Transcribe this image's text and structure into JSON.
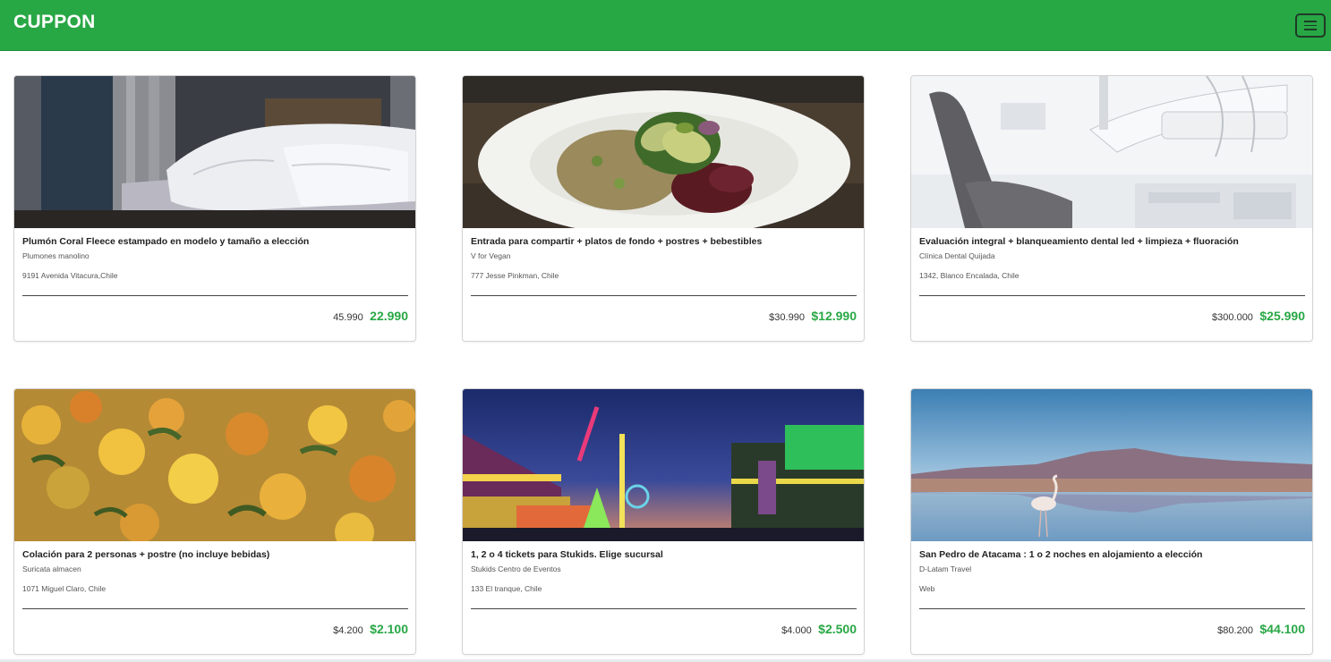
{
  "brand": {
    "name": "CUPPON",
    "color": "#28a745"
  },
  "nav": {
    "menu_icon": "hamburger-menu-icon"
  },
  "cards": [
    {
      "image": "bed-with-white-duvet-photo",
      "title": "Plumón Coral Fleece estampado en modelo y tamaño a elección",
      "merchant": "Plumones manolino",
      "address": "9191 Avenida Vitacura,Chile",
      "divider": "___________________________________________________________________________",
      "old_price": "45.990",
      "new_price": "22.990"
    },
    {
      "image": "vegan-salad-bowl-with-avocado-photo",
      "title": "Entrada para compartir + platos de fondo + postres + bebestibles",
      "merchant": "V for Vegan",
      "address": "777 Jesse Pinkman, Chile",
      "divider": "___________________________________________________________________________",
      "old_price": "$30.990",
      "new_price": "$12.990"
    },
    {
      "image": "dental-chair-clinic-photo",
      "title": "Evaluación integral + blanqueamiento dental led + limpieza + fluoración",
      "merchant": "Clínica Dental Quijada",
      "address": "1342, Blanco Encalada, Chile",
      "divider": "___________________________________________________________________________",
      "old_price": "$300.000",
      "new_price": "$25.990"
    },
    {
      "image": "vegetable-quinoa-dish-photo",
      "title": "Colación para 2 personas + postre (no incluye bebidas)",
      "merchant": "Suricata almacen",
      "address": "1071 Miguel Claro, Chile",
      "divider": "___________________________________________________________________________",
      "old_price": "$4.200",
      "new_price": "$2.100"
    },
    {
      "image": "amusement-park-at-night-photo",
      "title": "1, 2 o 4 tickets para Stukids. Elige sucursal",
      "merchant": "Stukids Centro de Eventos",
      "address": "133 El tranque, Chile",
      "divider": "___________________________________________________________________________",
      "old_price": "$4.000",
      "new_price": "$2.500"
    },
    {
      "image": "flamingo-salt-lake-atacama-photo",
      "title": "San Pedro de Atacama : 1 o 2 noches en alojamiento a elección",
      "merchant": "D-Latam Travel",
      "address": "Web",
      "divider": "___________________________________________________________________________",
      "old_price": "$80.200",
      "new_price": "$44.100"
    }
  ]
}
